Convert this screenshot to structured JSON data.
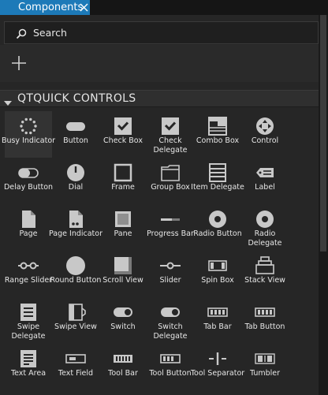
{
  "tab": {
    "title": "Components"
  },
  "search": {
    "label": "Search"
  },
  "section": {
    "title": "QTQUICK CONTROLS"
  },
  "colors": {
    "accent": "#1d7ab8",
    "icon": "#c8c8c8",
    "background": "#262626"
  },
  "components": [
    {
      "label": "Busy Indicator",
      "icon": "busy-indicator"
    },
    {
      "label": "Button",
      "icon": "button"
    },
    {
      "label": "Check Box",
      "icon": "check-box"
    },
    {
      "label": "Check Delegate",
      "icon": "check-delegate"
    },
    {
      "label": "Combo Box",
      "icon": "combo-box"
    },
    {
      "label": "Control",
      "icon": "control"
    },
    {
      "label": "Delay Button",
      "icon": "delay-button"
    },
    {
      "label": "Dial",
      "icon": "dial"
    },
    {
      "label": "Frame",
      "icon": "frame"
    },
    {
      "label": "Group Box",
      "icon": "group-box"
    },
    {
      "label": "Item Delegate",
      "icon": "item-delegate"
    },
    {
      "label": "Label",
      "icon": "label"
    },
    {
      "label": "Page",
      "icon": "page"
    },
    {
      "label": "Page Indicator",
      "icon": "page-indicator"
    },
    {
      "label": "Pane",
      "icon": "pane"
    },
    {
      "label": "Progress Bar",
      "icon": "progress-bar"
    },
    {
      "label": "Radio Button",
      "icon": "radio-button"
    },
    {
      "label": "Radio Delegate",
      "icon": "radio-delegate"
    },
    {
      "label": "Range Slider",
      "icon": "range-slider"
    },
    {
      "label": "Round Button",
      "icon": "round-button"
    },
    {
      "label": "Scroll View",
      "icon": "scroll-view"
    },
    {
      "label": "Slider",
      "icon": "slider"
    },
    {
      "label": "Spin Box",
      "icon": "spin-box"
    },
    {
      "label": "Stack View",
      "icon": "stack-view"
    },
    {
      "label": "Swipe Delegate",
      "icon": "swipe-delegate"
    },
    {
      "label": "Swipe View",
      "icon": "swipe-view"
    },
    {
      "label": "Switch",
      "icon": "switch"
    },
    {
      "label": "Switch Delegate",
      "icon": "switch-delegate"
    },
    {
      "label": "Tab Bar",
      "icon": "tab-bar"
    },
    {
      "label": "Tab Button",
      "icon": "tab-button"
    },
    {
      "label": "Text Area",
      "icon": "text-area"
    },
    {
      "label": "Text Field",
      "icon": "text-field"
    },
    {
      "label": "Tool Bar",
      "icon": "tool-bar"
    },
    {
      "label": "Tool Button",
      "icon": "tool-button"
    },
    {
      "label": "Tool Separator",
      "icon": "tool-separator"
    },
    {
      "label": "Tumbler",
      "icon": "tumbler"
    }
  ]
}
